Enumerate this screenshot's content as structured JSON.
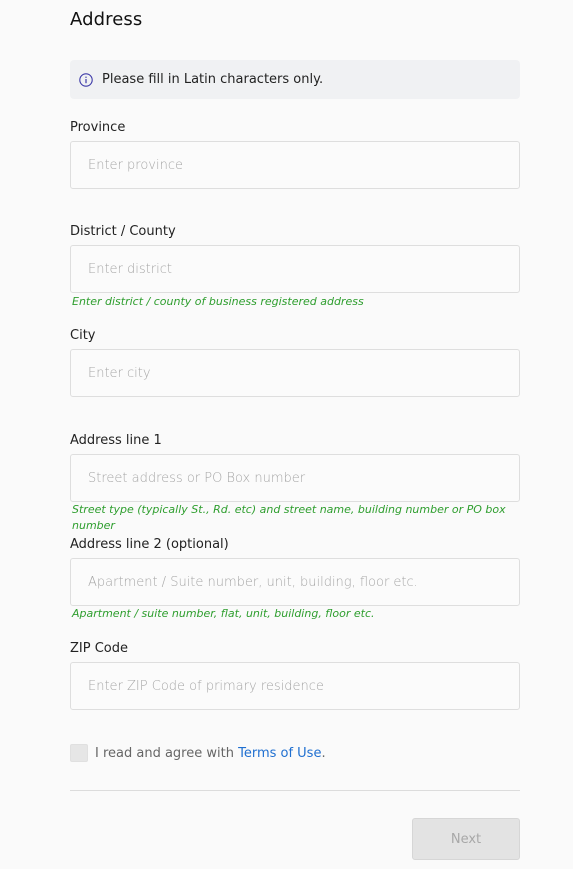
{
  "title": "Address",
  "notice": {
    "text": "Please fill in Latin characters only.",
    "icon": "info-icon"
  },
  "fields": {
    "province": {
      "label": "Province",
      "placeholder": "Enter province",
      "value": ""
    },
    "district": {
      "label": "District / County",
      "placeholder": "Enter district",
      "value": "",
      "hint": "Enter district / county of business registered address"
    },
    "city": {
      "label": "City",
      "placeholder": "Enter city",
      "value": ""
    },
    "address1": {
      "label": "Address line 1",
      "placeholder": "Street address or PO Box number",
      "value": "",
      "hint": "Street type (typically St., Rd. etc) and street name, building number or PO box number"
    },
    "address2": {
      "label": "Address line 2 (optional)",
      "placeholder": "Apartment / Suite number, unit, building, floor etc.",
      "value": "",
      "hint": "Apartment / suite number, flat, unit, building, floor etc."
    },
    "zip": {
      "label": "ZIP Code",
      "placeholder": "Enter ZIP Code of primary residence",
      "value": ""
    }
  },
  "agreement": {
    "prefix": "I read and agree with ",
    "link": "Terms of Use",
    "suffix": ".",
    "checked": false
  },
  "next_label": "Next",
  "colors": {
    "hint": "#2e9e2e",
    "link": "#1f6fd0",
    "notice_bg": "#f0f1f3",
    "info_icon": "#3d3aa8"
  }
}
